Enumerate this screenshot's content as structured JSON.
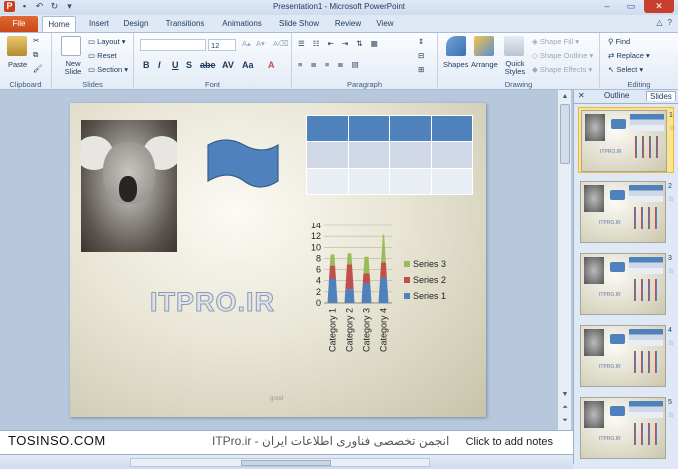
{
  "window": {
    "title": "Presentation1 - Microsoft PowerPoint"
  },
  "tabs": [
    "File",
    "Home",
    "Insert",
    "Design",
    "Transitions",
    "Animations",
    "Slide Show",
    "Review",
    "View"
  ],
  "ribbon": {
    "clipboard": {
      "label": "Clipboard",
      "paste": "Paste"
    },
    "slides": {
      "label": "Slides",
      "new_slide": "New Slide",
      "layout": "Layout",
      "reset": "Reset",
      "section": "Section"
    },
    "font": {
      "label": "Font",
      "size": "12"
    },
    "paragraph": {
      "label": "Paragraph"
    },
    "drawing": {
      "label": "Drawing",
      "shapes": "Shapes",
      "arrange": "Arrange",
      "quick_styles": "Quick Styles",
      "shape_fill": "Shape Fill",
      "shape_outline": "Shape Outline",
      "shape_effects": "Shape Effects"
    },
    "editing": {
      "label": "Editing",
      "find": "Find",
      "replace": "Replace",
      "select": "Select"
    }
  },
  "slide": {
    "wordart": "ITPRO.IR",
    "small_text": "good"
  },
  "chart_data": {
    "type": "bar",
    "categories": [
      "Category 1",
      "Category 2",
      "Category 3",
      "Category 4"
    ],
    "series": [
      {
        "name": "Series 1",
        "values": [
          4.3,
          2.5,
          3.5,
          4.5
        ]
      },
      {
        "name": "Series 2",
        "values": [
          2.4,
          4.4,
          1.8,
          2.8
        ]
      },
      {
        "name": "Series 3",
        "values": [
          2,
          2,
          3,
          5
        ]
      }
    ],
    "stacked": true,
    "ylim": [
      0,
      14
    ],
    "yticks": [
      0,
      2,
      4,
      6,
      8,
      10,
      12,
      14
    ],
    "colors": [
      "#4f81bd",
      "#c0504d",
      "#9bbb59"
    ],
    "legend": "right"
  },
  "panel": {
    "outline_tab": "Outline",
    "slides_tab": "Slides",
    "thumb_numbers": [
      "1",
      "2",
      "3",
      "4",
      "5"
    ]
  },
  "notes": {
    "hint": "Click to add notes"
  },
  "watermark": {
    "left": "TOSINSO.COM",
    "right": "ITPro.ir - انجمن تخصصی فناوری اطلاعات ایران"
  }
}
